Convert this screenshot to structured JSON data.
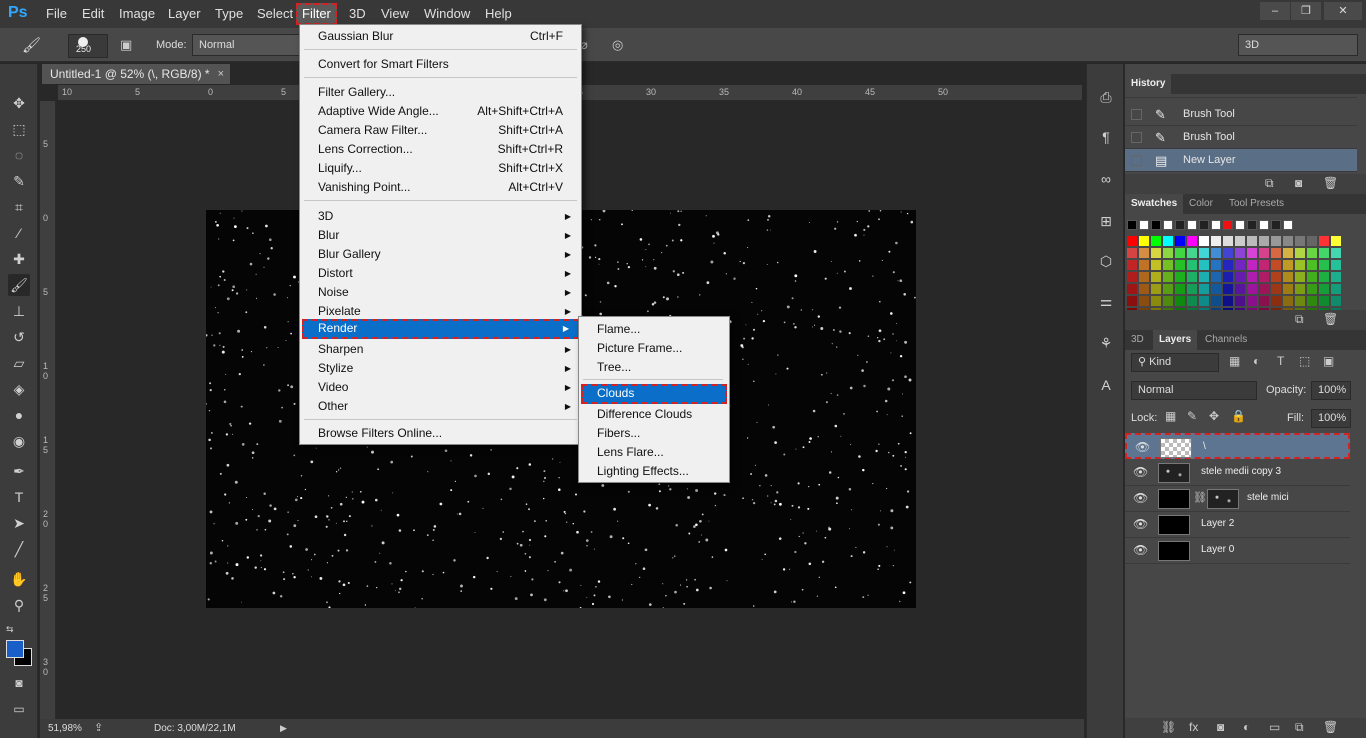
{
  "app": {
    "logo": "Ps"
  },
  "menubar": {
    "items": [
      "File",
      "Edit",
      "Image",
      "Layer",
      "Type",
      "Select",
      "Filter",
      "3D",
      "View",
      "Window",
      "Help"
    ],
    "window_controls": [
      "–",
      "❐",
      "✕"
    ]
  },
  "options": {
    "brush_size": "250",
    "mode_label": "Mode:",
    "mode_value": "Normal",
    "workspace": "3D"
  },
  "document": {
    "tab_title": "Untitled-1 @ 52% (\\, RGB/8) *",
    "tab_close": "×",
    "ruler_top_labels": [
      "10",
      "5",
      "0",
      "5",
      "10",
      "15",
      "20",
      "25",
      "30",
      "35",
      "40",
      "45",
      "50"
    ],
    "ruler_left_labels": [
      "5",
      "0",
      "5",
      "1 0",
      "1 5",
      "2 0",
      "2 5",
      "3 0"
    ]
  },
  "status": {
    "zoom": "51,98%",
    "doc_size": "Doc: 3,00M/22,1M"
  },
  "filter_menu": {
    "items": [
      {
        "label": "Gaussian Blur",
        "shortcut": "Ctrl+F"
      },
      {
        "label": "Convert for Smart Filters",
        "shortcut": ""
      },
      {
        "label": "Filter Gallery...",
        "shortcut": ""
      },
      {
        "label": "Adaptive Wide Angle...",
        "shortcut": "Alt+Shift+Ctrl+A"
      },
      {
        "label": "Camera Raw Filter...",
        "shortcut": "Shift+Ctrl+A"
      },
      {
        "label": "Lens Correction...",
        "shortcut": "Shift+Ctrl+R"
      },
      {
        "label": "Liquify...",
        "shortcut": "Shift+Ctrl+X"
      },
      {
        "label": "Vanishing Point...",
        "shortcut": "Alt+Ctrl+V"
      },
      {
        "label": "3D",
        "shortcut": ""
      },
      {
        "label": "Blur",
        "shortcut": ""
      },
      {
        "label": "Blur Gallery",
        "shortcut": ""
      },
      {
        "label": "Distort",
        "shortcut": ""
      },
      {
        "label": "Noise",
        "shortcut": ""
      },
      {
        "label": "Pixelate",
        "shortcut": ""
      },
      {
        "label": "Render",
        "shortcut": ""
      },
      {
        "label": "Sharpen",
        "shortcut": ""
      },
      {
        "label": "Stylize",
        "shortcut": ""
      },
      {
        "label": "Video",
        "shortcut": ""
      },
      {
        "label": "Other",
        "shortcut": ""
      },
      {
        "label": "Browse Filters Online...",
        "shortcut": ""
      }
    ]
  },
  "render_menu": {
    "items": [
      "Flame...",
      "Picture Frame...",
      "Tree...",
      "Clouds",
      "Difference Clouds",
      "Fibers...",
      "Lens Flare...",
      "Lighting Effects..."
    ]
  },
  "history": {
    "tab": "History",
    "rows": [
      "Brush Tool",
      "Brush Tool",
      "Brush Tool",
      "New Layer"
    ]
  },
  "swatches": {
    "tabs": [
      "Swatches",
      "Color",
      "Tool Presets"
    ]
  },
  "layers": {
    "tabs": [
      "3D",
      "Layers",
      "Channels"
    ],
    "kind_filter": "Kind",
    "blend_mode": "Normal",
    "opacity_label": "Opacity:",
    "opacity_value": "100%",
    "lock_label": "Lock:",
    "fill_label": "Fill:",
    "fill_value": "100%",
    "rows": [
      "\\",
      "stele medii copy 3",
      "stele mici",
      "Layer 2",
      "Layer 0"
    ]
  },
  "colors": {
    "accent": "#0b6ec9",
    "highlight_border": "#d42222",
    "foreground": "#1a5fc8",
    "background": "#000000"
  }
}
